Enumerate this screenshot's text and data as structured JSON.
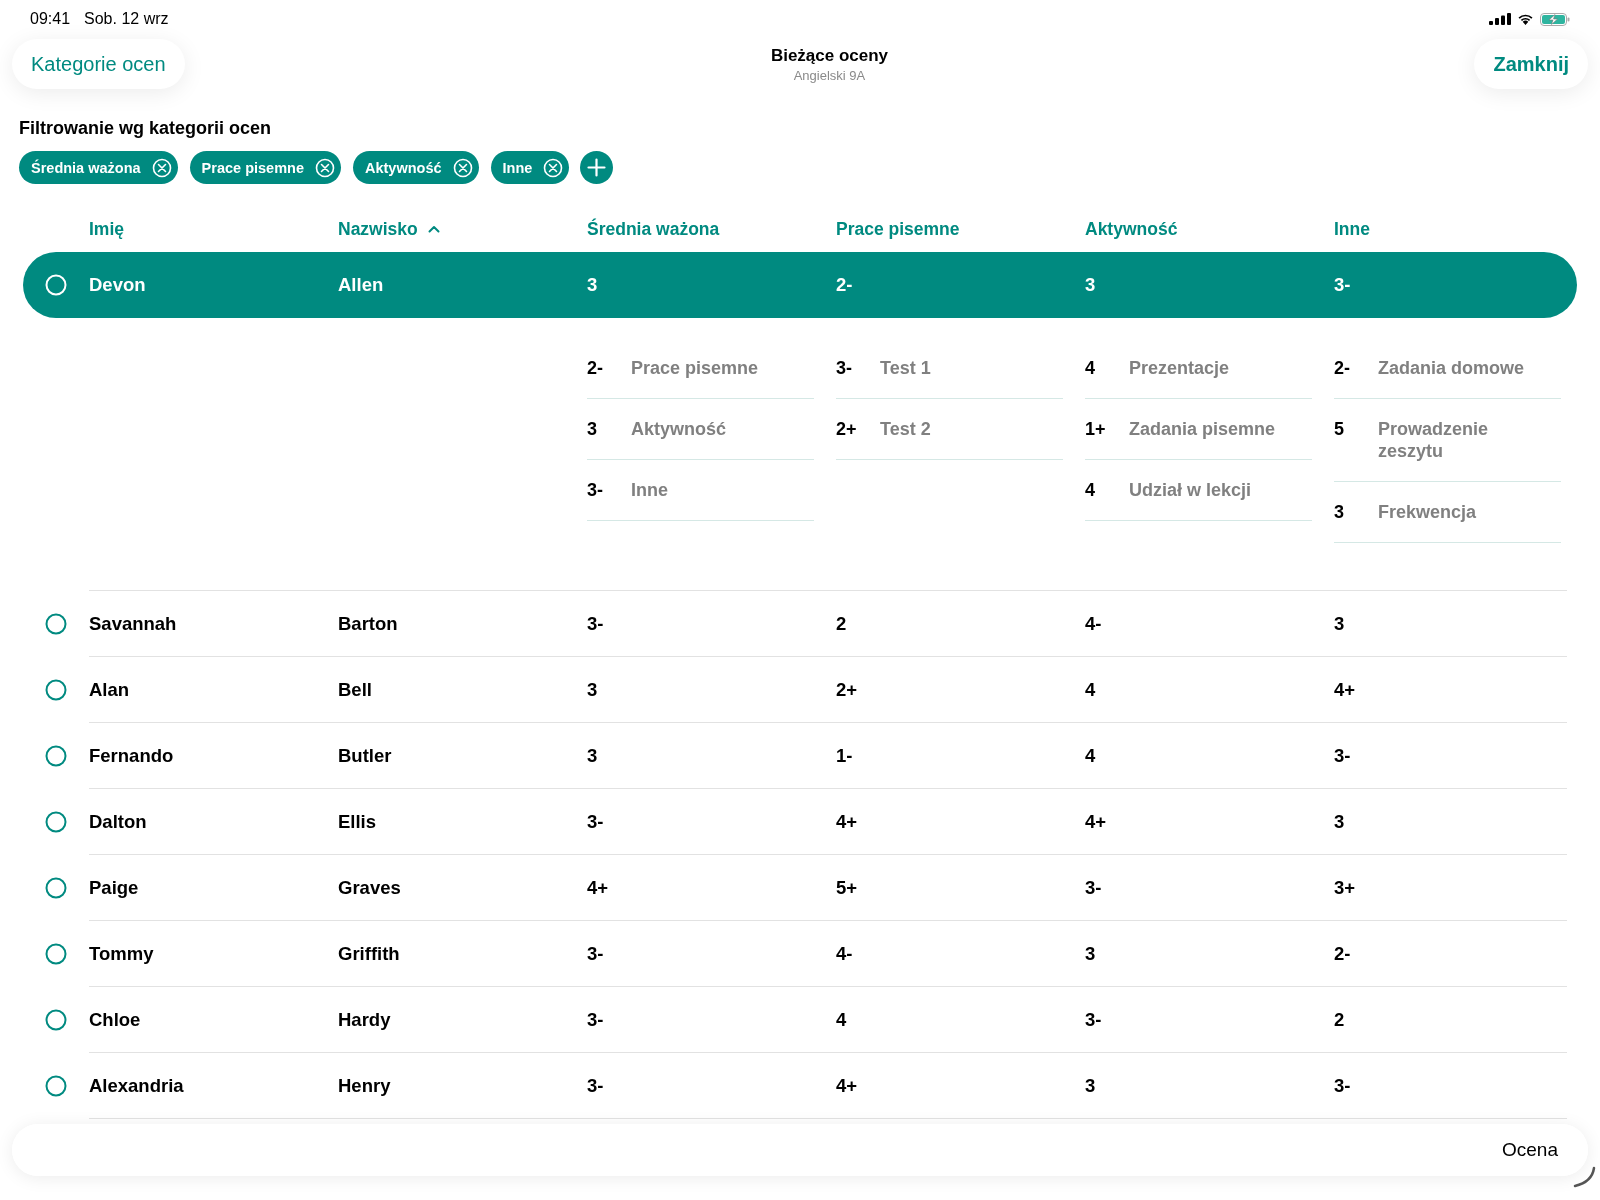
{
  "status_bar": {
    "time": "09:41",
    "date": "Sob. 12 wrz"
  },
  "header": {
    "left_button": "Kategorie ocen",
    "title": "Bieżące oceny",
    "subtitle": "Angielski 9A",
    "right_button": "Zamknij"
  },
  "filter": {
    "label": "Filtrowanie wg kategorii ocen",
    "chips": [
      "Średnia ważona",
      "Prace pisemne",
      "Aktywność",
      "Inne"
    ]
  },
  "table": {
    "columns": [
      {
        "label": "Imię",
        "sorted": false
      },
      {
        "label": "Nazwisko",
        "sorted": true
      },
      {
        "label": "Średnia ważona",
        "sorted": false
      },
      {
        "label": "Prace pisemne",
        "sorted": false
      },
      {
        "label": "Aktywność",
        "sorted": false
      },
      {
        "label": "Inne",
        "sorted": false
      }
    ],
    "rows": [
      {
        "cells": [
          "Devon",
          "Allen",
          "3",
          "2-",
          "3",
          "3-"
        ],
        "selected": true,
        "breakdown": [
          [
            {
              "grade": "2-",
              "label": "Prace pisemne"
            },
            {
              "grade": "3",
              "label": "Aktywność"
            },
            {
              "grade": "3-",
              "label": "Inne"
            }
          ],
          [
            {
              "grade": "3-",
              "label": "Test 1"
            },
            {
              "grade": "2+",
              "label": "Test 2"
            }
          ],
          [
            {
              "grade": "4",
              "label": "Prezentacje"
            },
            {
              "grade": "1+",
              "label": "Zadania pisemne"
            },
            {
              "grade": "4",
              "label": "Udział w lekcji"
            }
          ],
          [
            {
              "grade": "2-",
              "label": "Zadania domowe"
            },
            {
              "grade": "5",
              "label": "Prowadzenie zeszytu"
            },
            {
              "grade": "3",
              "label": "Frekwencja"
            }
          ]
        ]
      },
      {
        "cells": [
          "Savannah",
          "Barton",
          "3-",
          "2",
          "4-",
          "3"
        ],
        "selected": false
      },
      {
        "cells": [
          "Alan",
          "Bell",
          "3",
          "2+",
          "4",
          "4+"
        ],
        "selected": false
      },
      {
        "cells": [
          "Fernando",
          "Butler",
          "3",
          "1-",
          "4",
          "3-"
        ],
        "selected": false
      },
      {
        "cells": [
          "Dalton",
          "Ellis",
          "3-",
          "4+",
          "4+",
          "3"
        ],
        "selected": false
      },
      {
        "cells": [
          "Paige",
          "Graves",
          "4+",
          "5+",
          "3-",
          "3+"
        ],
        "selected": false
      },
      {
        "cells": [
          "Tommy",
          "Griffith",
          "3-",
          "4-",
          "3",
          "2-"
        ],
        "selected": false
      },
      {
        "cells": [
          "Chloe",
          "Hardy",
          "3-",
          "4",
          "3-",
          "2"
        ],
        "selected": false
      },
      {
        "cells": [
          "Alexandria",
          "Henry",
          "3-",
          "4+",
          "3",
          "3-"
        ],
        "selected": false
      }
    ]
  },
  "bottom_bar": {
    "label": "Ocena"
  }
}
